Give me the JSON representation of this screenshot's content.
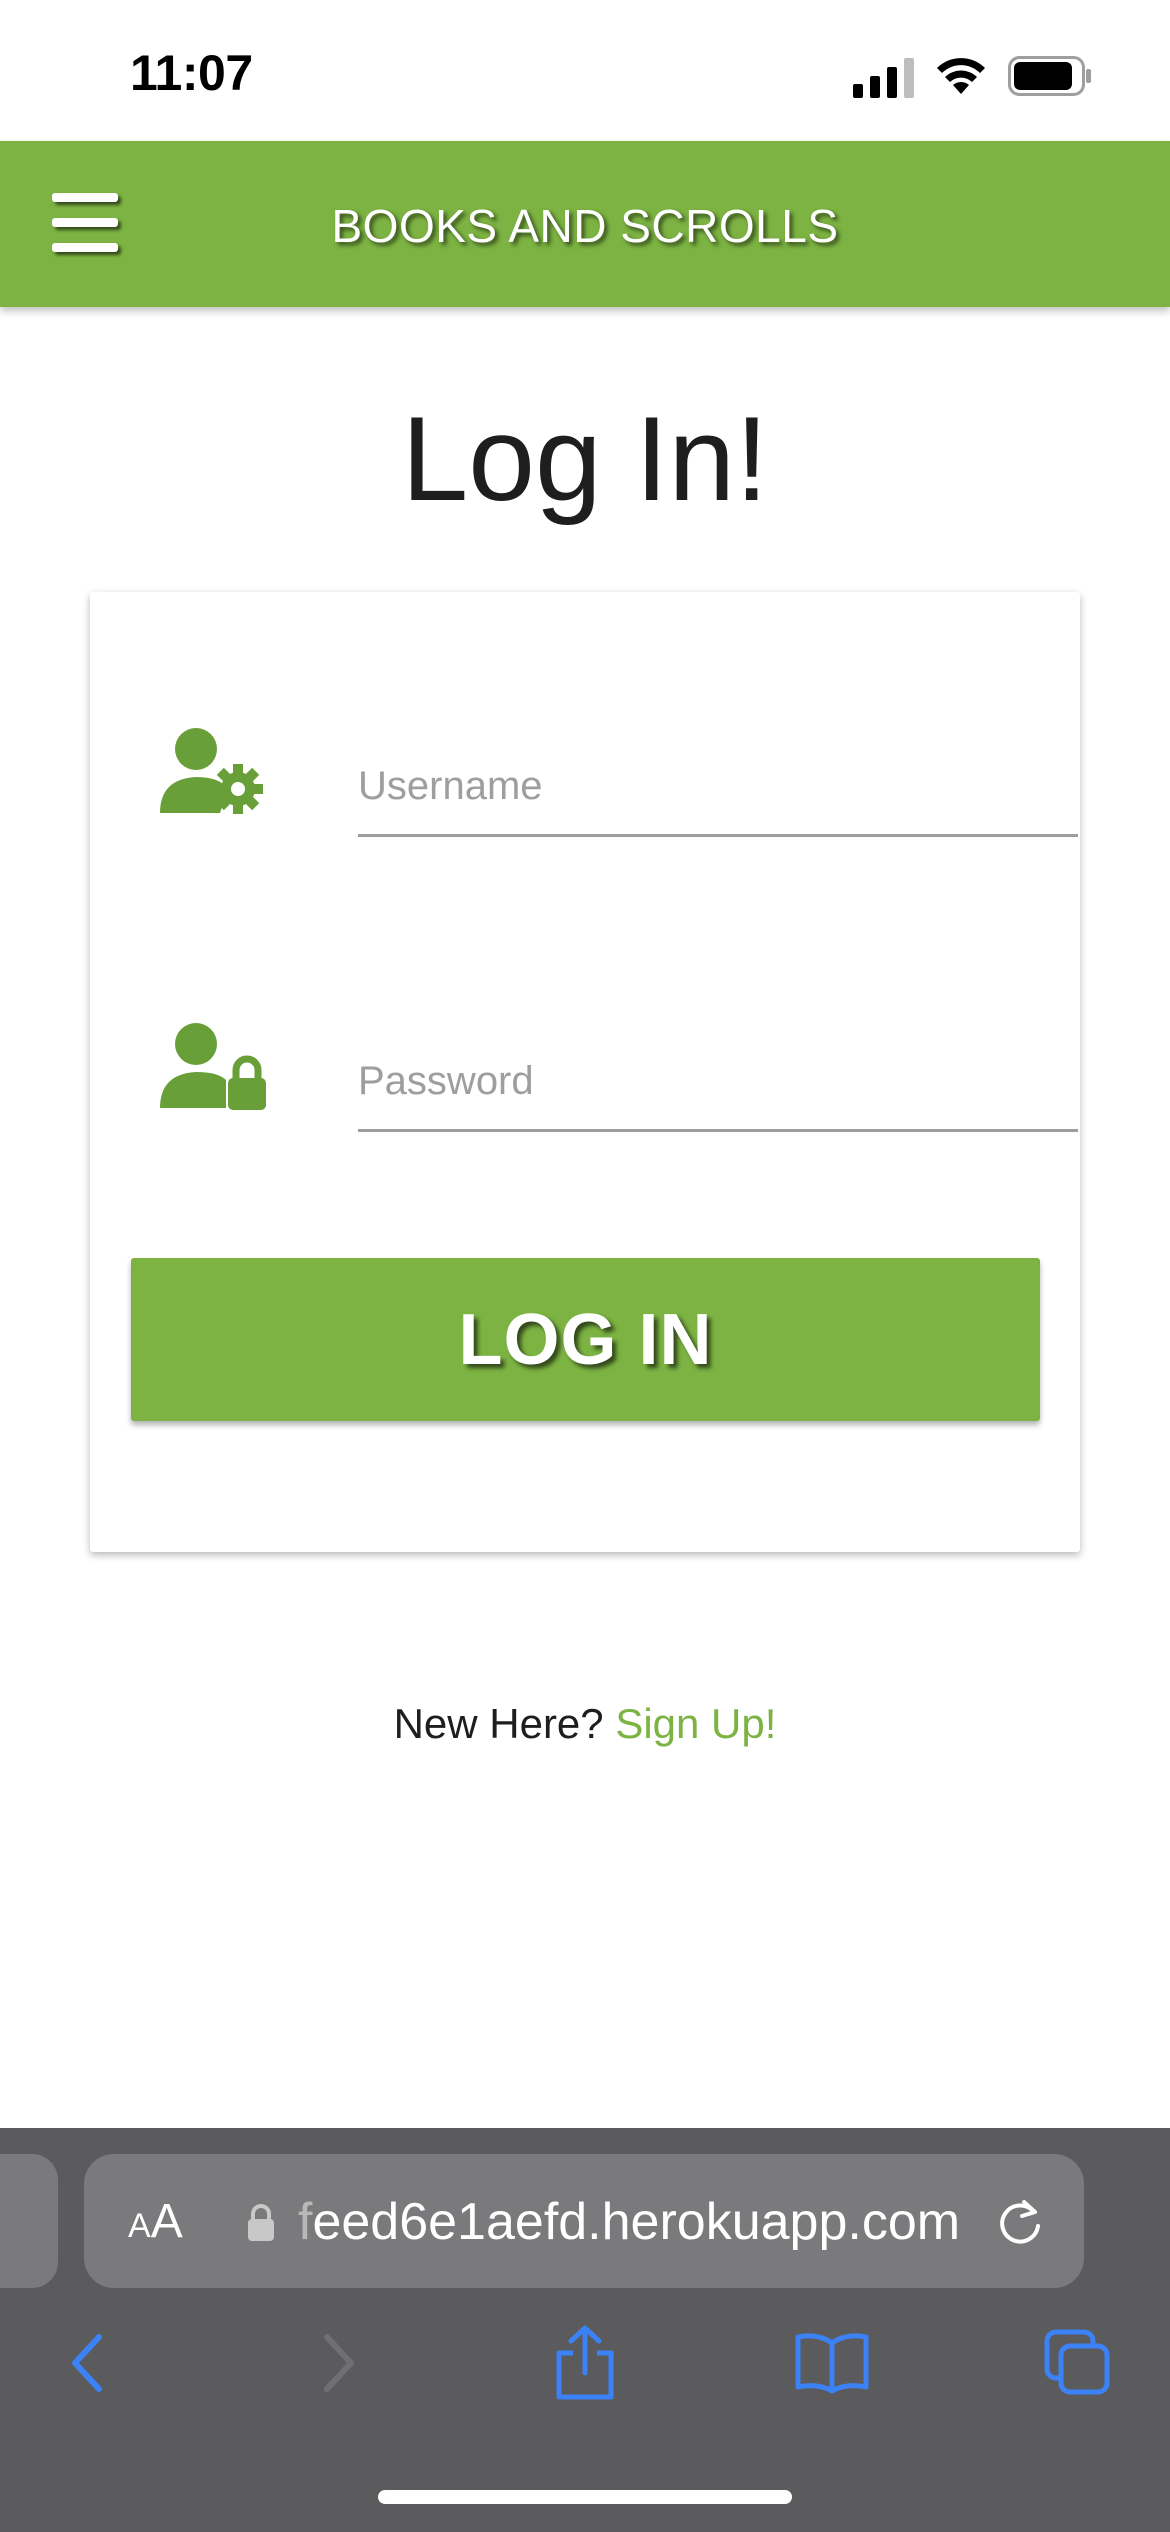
{
  "status_bar": {
    "time": "11:07",
    "icons": [
      "cellular-signal-icon",
      "wifi-icon",
      "battery-icon"
    ]
  },
  "navbar": {
    "brand": "BOOKS AND SCROLLS",
    "menu_icon": "hamburger-menu-icon"
  },
  "page": {
    "title": "Log In!"
  },
  "form": {
    "username": {
      "placeholder": "Username",
      "value": "",
      "icon": "user-gear-icon"
    },
    "password": {
      "placeholder": "Password",
      "value": "",
      "icon": "user-lock-icon"
    },
    "submit_label": "LOG IN"
  },
  "signup": {
    "prompt": "New Here?",
    "link_label": "Sign Up!"
  },
  "browser": {
    "text_size_label_small": "A",
    "text_size_label_large": "A",
    "url_prefix": "f",
    "url": "eed6e1aefd.herokuapp.com",
    "toolbar_icons": [
      "back-icon",
      "forward-icon",
      "share-icon",
      "bookmarks-icon",
      "tabs-icon"
    ]
  },
  "colors": {
    "brand_green": "#7cb342",
    "browser_bar": "#5b5b5d",
    "safari_blue": "#3b82f6"
  }
}
